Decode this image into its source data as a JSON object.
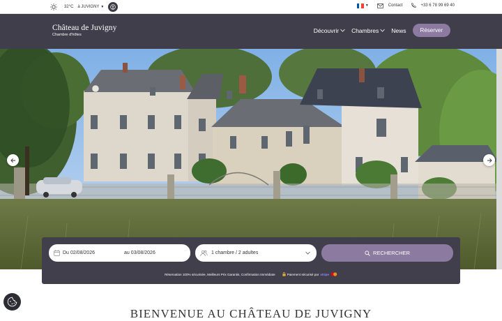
{
  "topbar": {
    "temperature": "32°C",
    "location": "à JUVIGNY",
    "contact_label": "Contact",
    "phone": "+33 6 78 99 69 40"
  },
  "brand": {
    "name": "Château de Juvigny",
    "subtitle": "Chambre d'hôtes"
  },
  "nav": {
    "discover": "Découvrir",
    "rooms": "Chambres",
    "news": "News",
    "book": "Réserver"
  },
  "booking": {
    "from_label": "Du",
    "from_date": "02/08/2026",
    "to_label": "au",
    "to_date": "03/08/2026",
    "guests": "1 chambre / 2 adultes",
    "search_label": "RECHERCHER",
    "assurance": "Réservation 100% sécurisée, Meilleurs Prix Garantis, Confirmation Immédiate",
    "secure_payment": "Paiement sécurisé par",
    "stripe": "stripe"
  },
  "welcome_title": "BIENVENUE AU CHÂTEAU DE JUVIGNY",
  "colors": {
    "nav_bg": "#403e4a",
    "accent": "#8c7aa0"
  }
}
